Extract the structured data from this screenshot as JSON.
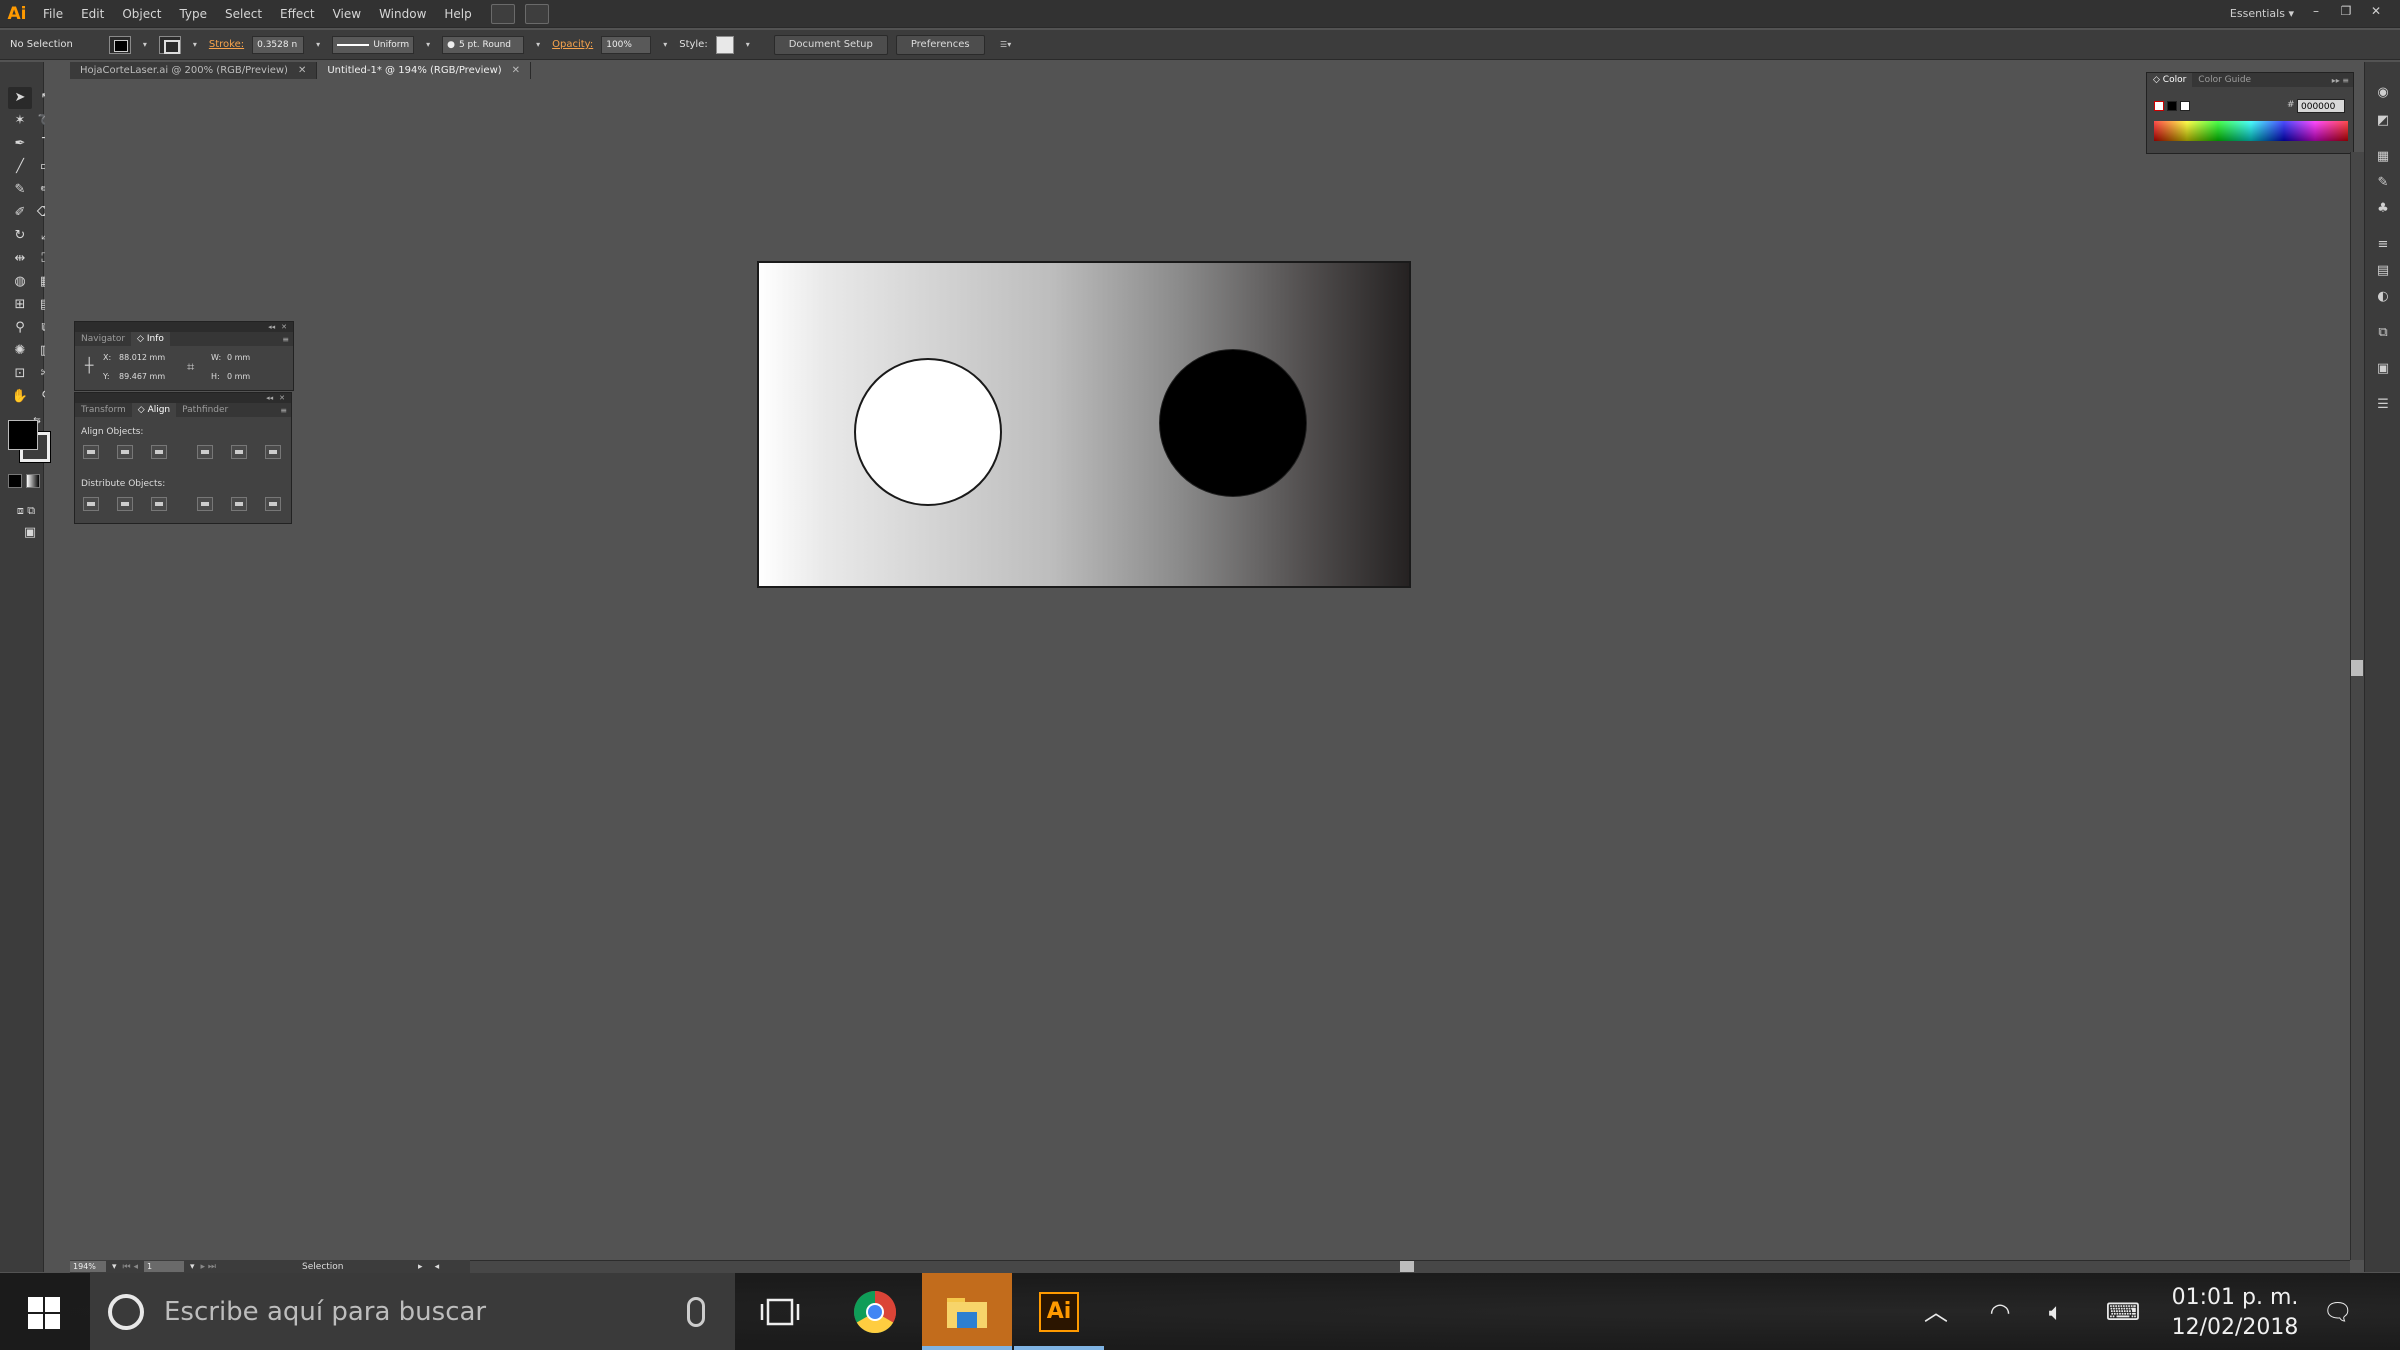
{
  "app": {
    "logo": "Ai",
    "workspace": "Essentials",
    "accent": "#ff9a00"
  },
  "menu": [
    "File",
    "Edit",
    "Object",
    "Type",
    "Select",
    "Effect",
    "View",
    "Window",
    "Help"
  ],
  "window_controls": {
    "minimize": "–",
    "restore": "❐",
    "close": "✕"
  },
  "control_bar": {
    "selection_status": "No Selection",
    "stroke_label": "Stroke:",
    "stroke_weight": "0.3528 n",
    "stroke_profile": "Uniform",
    "brush": "5 pt. Round",
    "opacity_label": "Opacity:",
    "opacity": "100%",
    "style_label": "Style:",
    "document_setup": "Document Setup",
    "preferences": "Preferences"
  },
  "tabs": [
    {
      "label": "HojaCorteLaser.ai @ 200% (RGB/Preview)",
      "close": "✕"
    },
    {
      "label": "Untitled-1* @ 194% (RGB/Preview)",
      "close": "✕"
    }
  ],
  "info_panel": {
    "tabs": [
      "Navigator",
      "◇ Info"
    ],
    "x_label": "X:",
    "x": "88.012 mm",
    "y_label": "Y:",
    "y": "89.467 mm",
    "w_label": "W:",
    "w": "0 mm",
    "h_label": "H:",
    "h": "0 mm"
  },
  "align_panel": {
    "tabs": [
      "Transform",
      "◇ Align",
      "Pathfinder"
    ],
    "align_objects": "Align Objects:",
    "distribute_objects": "Distribute Objects:"
  },
  "color_panel": {
    "tabs": [
      "◇ Color",
      "Color Guide"
    ],
    "hex_label": "#",
    "hex": "000000"
  },
  "status_bar": {
    "zoom": "194%",
    "artboard": "1",
    "tool": "Selection"
  },
  "taskbar": {
    "search_placeholder": "Escribe aquí para buscar",
    "time": "01:01 p. m.",
    "date": "12/02/2018",
    "ai_icon": "Ai"
  }
}
